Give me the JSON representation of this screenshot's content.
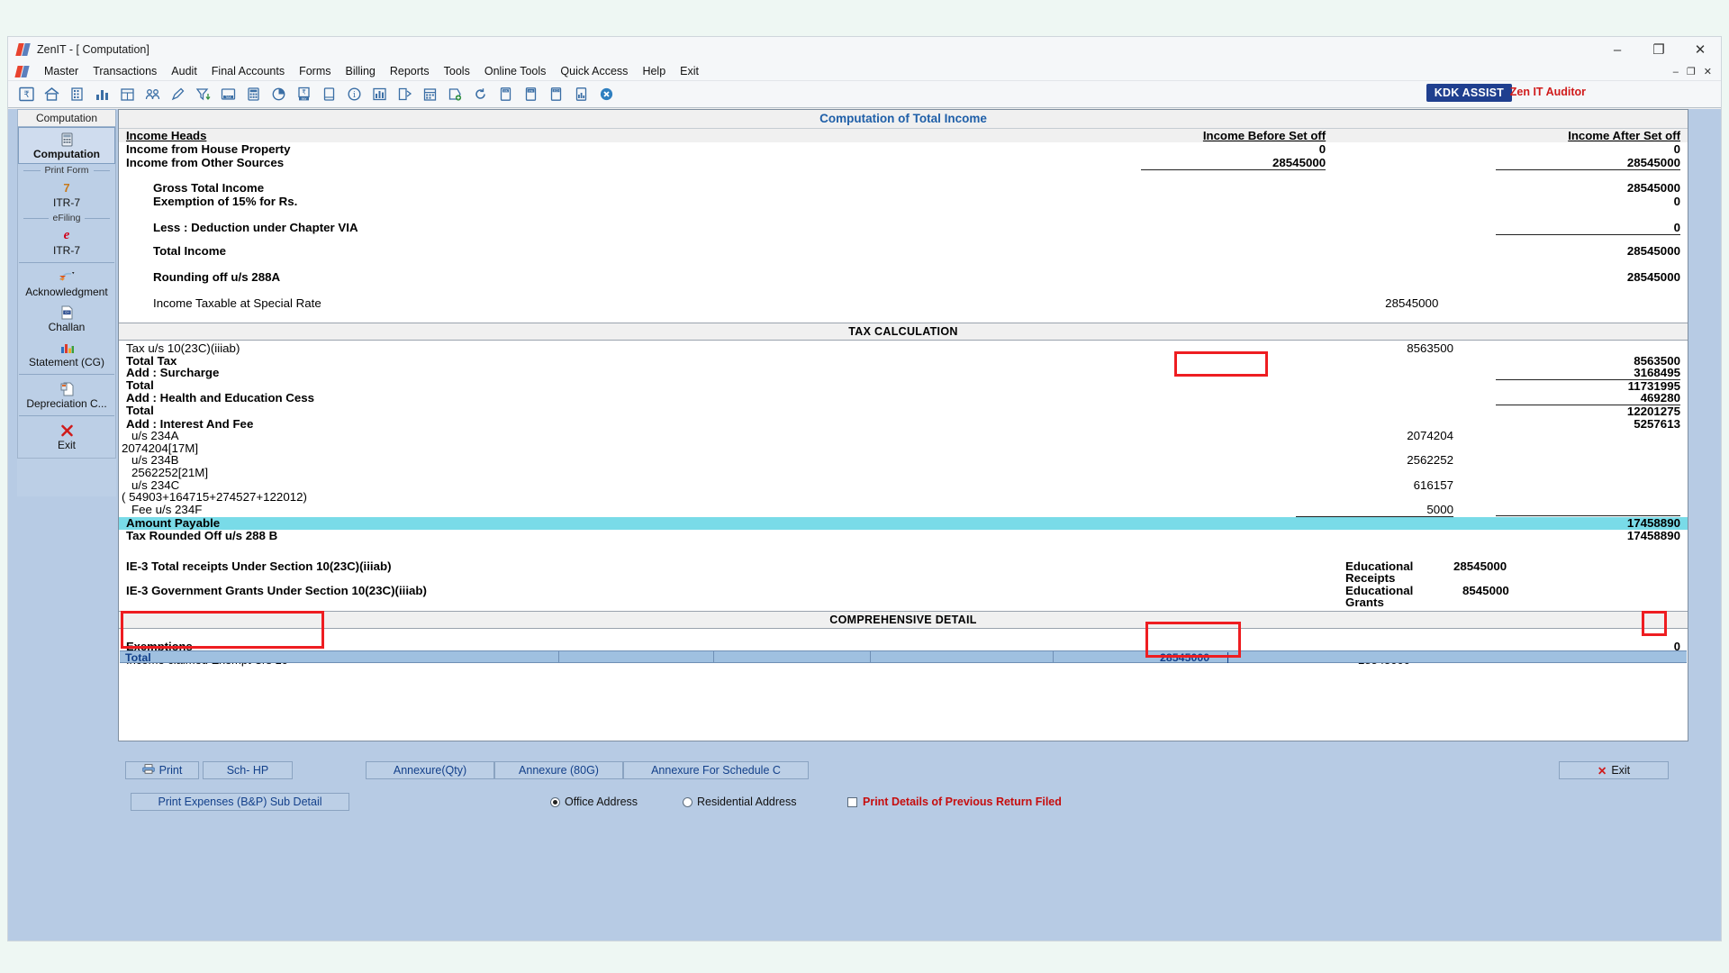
{
  "window": {
    "title": "ZenIT - [ Computation]",
    "minimize": "–",
    "maximize": "❐",
    "close": "✕",
    "mdi_minimize": "–",
    "mdi_restore": "❐",
    "mdi_close": "✕"
  },
  "menu": {
    "items": [
      {
        "label": "Master",
        "accel": "M"
      },
      {
        "label": "Transactions",
        "accel": "T"
      },
      {
        "label": "Audit",
        "accel": "d"
      },
      {
        "label": "Final Accounts",
        "accel": "A"
      },
      {
        "label": "Forms",
        "accel": "o"
      },
      {
        "label": "Billing",
        "accel": "B"
      },
      {
        "label": "Reports",
        "accel": "R"
      },
      {
        "label": "Tools",
        "accel": "l"
      },
      {
        "label": "Online Tools",
        "accel": "n"
      },
      {
        "label": "Quick Access",
        "accel": "Q"
      },
      {
        "label": "Help",
        "accel": "H"
      },
      {
        "label": "Exit",
        "accel": "E"
      }
    ]
  },
  "toolbar": {
    "kdk_assist": "KDK ASSIST",
    "zenit_auditor": "Zen IT Auditor",
    "icons": [
      "rupee-document-icon",
      "home-icon",
      "building-icon",
      "bar-chart-icon",
      "calendar-grid-icon",
      "group-icon",
      "pencil-icon",
      "filter-down-icon",
      "tax-icon",
      "calculator-icon",
      "pie-chart-icon",
      "pay-icon",
      "book-icon",
      "info-circle-icon",
      "chart-columns-icon",
      "export-icon",
      "date-icon",
      "add-tag-icon",
      "refresh-icon",
      "ds-card-icon",
      "itr-sign-icon",
      "3cd-icon",
      "form-chart-icon",
      "close-circle-icon"
    ]
  },
  "sidebar": {
    "header": "Computation",
    "items": [
      {
        "label": "Computation",
        "icon": "computation-icon",
        "active": true
      },
      {
        "separator": "Print Form"
      },
      {
        "label": "ITR-7",
        "icon": "itr7-number-icon",
        "badge": "7",
        "accel": "7"
      },
      {
        "separator": "eFiling"
      },
      {
        "label": "ITR-7",
        "icon": "efiling-e-icon"
      },
      {
        "label": "Acknowledgment",
        "icon": "acknowledgment-icon",
        "accel": "A"
      },
      {
        "label": "Challan",
        "icon": "challan-icon",
        "accel": "h"
      },
      {
        "label": "Statement (CG)",
        "icon": "statement-cg-icon",
        "accel": "C"
      },
      {
        "label": "Depreciation C...",
        "icon": "depreciation-icon",
        "accel": "p"
      },
      {
        "label": "Exit",
        "icon": "exit-x-icon",
        "accel": "x"
      }
    ]
  },
  "document": {
    "title": "Computation of Total Income",
    "columns": {
      "income_heads": "Income Heads",
      "before_setoff": "Income Before Set off",
      "after_setoff": "Income After Set off"
    },
    "income_rows": [
      {
        "label": "Income from House Property",
        "before": "0",
        "after": "0",
        "indent": 0,
        "bold": true,
        "rule": false
      },
      {
        "label": "Income from Other Sources",
        "before": "28545000",
        "after": "28545000",
        "indent": 0,
        "bold": true,
        "rule": true
      },
      {
        "label": "Gross Total Income",
        "before": "",
        "after": "28545000",
        "indent": 1,
        "bold": true,
        "rule": false
      },
      {
        "label": "Exemption of 15% for Rs.",
        "before": "",
        "after": "0",
        "indent": 1,
        "bold": true,
        "rule": false
      },
      {
        "label": "Less : Deduction under Chapter VIA",
        "before": "",
        "after": "0",
        "indent": 1,
        "bold": true,
        "rule": true
      },
      {
        "label": "Total Income",
        "before": "",
        "after": "28545000",
        "indent": 1,
        "bold": true,
        "rule": false
      },
      {
        "label": "Rounding off u/s 288A",
        "before": "",
        "after": "28545000",
        "indent": 1,
        "bold": true,
        "rule": false
      },
      {
        "label": "Income Taxable at Special Rate",
        "before": "",
        "after": "",
        "special": "28545000",
        "indent": 1,
        "bold": false,
        "rule": false
      }
    ],
    "tax_section_title": "TAX CALCULATION",
    "tax_rows": [
      {
        "label": "Tax u/s 10(23C)(iiiab)",
        "c1": "8563500",
        "c2": "",
        "bold": false,
        "indent": 0,
        "highlight_c1": true
      },
      {
        "label": "Total Tax",
        "c1": "",
        "c2": "8563500",
        "bold": true,
        "indent": 0
      },
      {
        "label": "Add : Surcharge",
        "c1": "",
        "c2": "3168495",
        "bold": true,
        "indent": 0
      },
      {
        "label": "Total",
        "c1": "",
        "c2": "11731995",
        "bold": true,
        "indent": 0,
        "rule_c2": true
      },
      {
        "label": "Add : Health and Education Cess",
        "c1": "",
        "c2": "469280",
        "bold": true,
        "indent": 0
      },
      {
        "label": "Total",
        "c1": "",
        "c2": "12201275",
        "bold": true,
        "indent": 0,
        "rule_c2": true
      },
      {
        "label": "Add : Interest And Fee",
        "c1": "",
        "c2": "5257613",
        "bold": true,
        "indent": 0
      },
      {
        "label": "u/s 234A",
        "c1": "2074204",
        "c2": "",
        "bold": false,
        "indent": 1
      },
      {
        "label": "2074204[17M]",
        "c1": "",
        "c2": "",
        "bold": false,
        "indent": 0
      },
      {
        "label": "u/s 234B",
        "c1": "2562252",
        "c2": "",
        "bold": false,
        "indent": 1
      },
      {
        "label": "2562252[21M]",
        "c1": "",
        "c2": "",
        "bold": false,
        "indent": 1
      },
      {
        "label": "u/s 234C",
        "c1": "616157",
        "c2": "",
        "bold": false,
        "indent": 1
      },
      {
        "label": "(  54903+164715+274527+122012)",
        "c1": "",
        "c2": "",
        "bold": false,
        "indent": 0
      },
      {
        "label": "Fee u/s 234F",
        "c1": "5000",
        "c2": "",
        "bold": false,
        "indent": 1,
        "rule_c1": true
      }
    ],
    "amount_payable": {
      "label": "Amount Payable",
      "value": "17458890"
    },
    "tax_rounded": {
      "label": "Tax Rounded Off u/s 288 B",
      "value": "17458890"
    },
    "ie_rows": [
      {
        "label": "IE-3 Total receipts Under Section 10(23C)(iiiab)",
        "mid": "Educational Receipts",
        "value": "28545000"
      },
      {
        "label": "IE-3 Government Grants Under Section 10(23C)(iiiab)",
        "mid": "Educational Grants",
        "value": "8545000"
      }
    ],
    "comprehensive_title": "COMPREHENSIVE DETAIL",
    "exemptions": {
      "heading": "Exemptions",
      "row_label": "Income claimed Exempt U/s 10",
      "row_value": "28545000",
      "right_value": "0",
      "total_label": "Total",
      "total_value": "28545000"
    }
  },
  "buttons": {
    "print": "Print",
    "sch_hp": "Sch- HP",
    "annexure_qty": "Annexure(Qty)",
    "annexure_80g": "Annexure (80G)",
    "annexure_schedule_c": "Annexure For Schedule C",
    "exit": "Exit",
    "print_expenses": "Print Expenses (B&P) Sub Detail",
    "office_address": "Office Address",
    "residential_address": "Residential Address",
    "print_prev_return": "Print Details of Previous Return Filed"
  },
  "colors": {
    "accent_blue": "#1f5fa8",
    "highlight_red": "#ee1d21",
    "amount_payable_bg": "#79dbe8",
    "sidebar_bg": "#bccfe6",
    "panel_bg": "#b7cbe4"
  }
}
